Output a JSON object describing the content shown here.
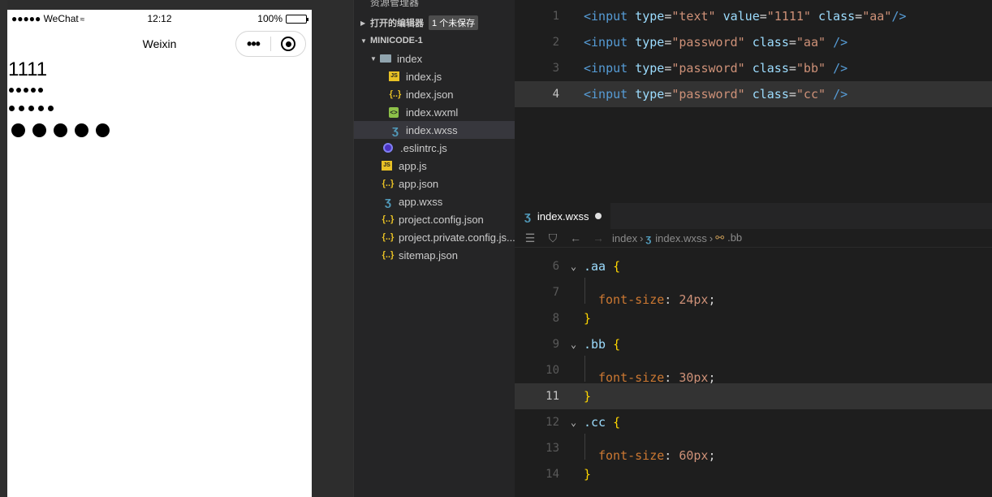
{
  "simulator": {
    "status": {
      "carrier": "●●●●● WeChat",
      "time": "12:12",
      "battery": "100%"
    },
    "nav_title": "Weixin",
    "capsule_more": "•••",
    "page": {
      "text_input_value": "1111",
      "aa_dots": 5,
      "bb_dots": 5,
      "cc_dots": 5
    }
  },
  "explorer": {
    "title": "资源管理器",
    "open_editors": {
      "label": "打开的编辑器",
      "badge": "1 个未保存"
    },
    "project": "MINICODE-1",
    "folder": "index",
    "files": [
      {
        "name": "index.js",
        "icon": "js-file-icon"
      },
      {
        "name": "index.json",
        "icon": "json-file-icon"
      },
      {
        "name": "index.wxml",
        "icon": "wxml-file-icon"
      },
      {
        "name": "index.wxss",
        "icon": "wxss-file-icon"
      }
    ],
    "root_files": [
      {
        "name": ".eslintrc.js",
        "icon": "eslint-file-icon"
      },
      {
        "name": "app.js",
        "icon": "js-file-icon"
      },
      {
        "name": "app.json",
        "icon": "json-file-icon"
      },
      {
        "name": "app.wxss",
        "icon": "wxss-file-icon"
      },
      {
        "name": "project.config.json",
        "icon": "json-file-icon"
      },
      {
        "name": "project.private.config.js...",
        "icon": "json-file-icon"
      },
      {
        "name": "sitemap.json",
        "icon": "json-file-icon"
      }
    ]
  },
  "wxml_editor": {
    "lines": [
      {
        "n": "1",
        "tokens": [
          [
            "tag",
            "<input"
          ],
          [
            "plain",
            " "
          ],
          [
            "attr",
            "type"
          ],
          [
            "plain",
            "="
          ],
          [
            "str",
            "\"text\""
          ],
          [
            "plain",
            " "
          ],
          [
            "attr",
            "value"
          ],
          [
            "plain",
            "="
          ],
          [
            "str",
            "\"1111\""
          ],
          [
            "plain",
            " "
          ],
          [
            "attr",
            "class"
          ],
          [
            "plain",
            "="
          ],
          [
            "str",
            "\"aa\""
          ],
          [
            "tag",
            "/>"
          ]
        ]
      },
      {
        "n": "2",
        "tokens": [
          [
            "tag",
            "<input"
          ],
          [
            "plain",
            " "
          ],
          [
            "attr",
            "type"
          ],
          [
            "plain",
            "="
          ],
          [
            "str",
            "\"password\""
          ],
          [
            "plain",
            " "
          ],
          [
            "attr",
            "class"
          ],
          [
            "plain",
            "="
          ],
          [
            "str",
            "\"aa\""
          ],
          [
            "plain",
            " "
          ],
          [
            "tag",
            "/>"
          ]
        ]
      },
      {
        "n": "3",
        "tokens": [
          [
            "tag",
            "<input"
          ],
          [
            "plain",
            " "
          ],
          [
            "attr",
            "type"
          ],
          [
            "plain",
            "="
          ],
          [
            "str",
            "\"password\""
          ],
          [
            "plain",
            " "
          ],
          [
            "attr",
            "class"
          ],
          [
            "plain",
            "="
          ],
          [
            "str",
            "\"bb\""
          ],
          [
            "plain",
            " "
          ],
          [
            "tag",
            "/>"
          ]
        ]
      },
      {
        "n": "4",
        "tokens": [
          [
            "tag",
            "<input"
          ],
          [
            "plain",
            " "
          ],
          [
            "attr",
            "type"
          ],
          [
            "plain",
            "="
          ],
          [
            "str",
            "\"password\""
          ],
          [
            "plain",
            " "
          ],
          [
            "attr",
            "class"
          ],
          [
            "plain",
            "="
          ],
          [
            "str",
            "\"cc\""
          ],
          [
            "plain",
            " "
          ],
          [
            "tag",
            "/>"
          ]
        ]
      }
    ]
  },
  "wxss_editor": {
    "tab_label": "index.wxss",
    "breadcrumb": [
      "index",
      "index.wxss",
      ".bb"
    ],
    "lines": [
      {
        "n": "6",
        "fold": true,
        "tokens": [
          [
            "sel",
            ".aa"
          ],
          [
            "plain",
            " "
          ],
          [
            "brace",
            "{"
          ]
        ]
      },
      {
        "n": "7",
        "guide": true,
        "tokens": [
          [
            "prop",
            "font-size"
          ],
          [
            "plain",
            ": "
          ],
          [
            "num",
            "24px"
          ],
          [
            "plain",
            ";"
          ]
        ]
      },
      {
        "n": "8",
        "tokens": [
          [
            "brace",
            "}"
          ]
        ]
      },
      {
        "n": "9",
        "fold": true,
        "tokens": [
          [
            "sel",
            ".bb"
          ],
          [
            "plain",
            " "
          ],
          [
            "brace",
            "{"
          ]
        ]
      },
      {
        "n": "10",
        "guide": true,
        "tokens": [
          [
            "prop",
            "font-size"
          ],
          [
            "plain",
            ": "
          ],
          [
            "num",
            "30px"
          ],
          [
            "plain",
            ";"
          ]
        ]
      },
      {
        "n": "11",
        "tokens": [
          [
            "brace",
            "}"
          ]
        ]
      },
      {
        "n": "12",
        "fold": true,
        "tokens": [
          [
            "sel",
            ".cc"
          ],
          [
            "plain",
            " "
          ],
          [
            "brace",
            "{"
          ]
        ]
      },
      {
        "n": "13",
        "guide": true,
        "tokens": [
          [
            "prop",
            "font-size"
          ],
          [
            "plain",
            ": "
          ],
          [
            "num",
            "60px"
          ],
          [
            "plain",
            ";"
          ]
        ]
      },
      {
        "n": "14",
        "tokens": [
          [
            "brace",
            "}"
          ]
        ]
      }
    ]
  }
}
